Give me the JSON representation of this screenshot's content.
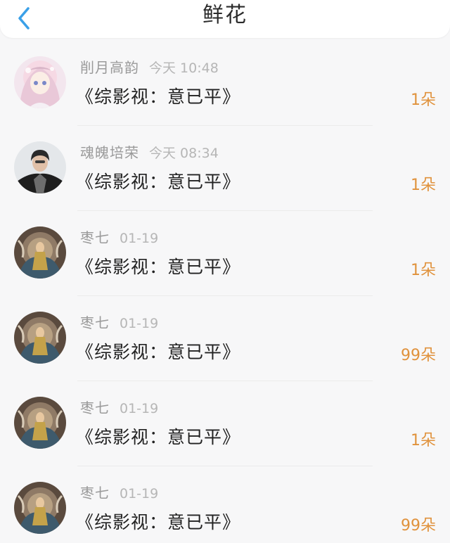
{
  "header": {
    "title": "鲜花",
    "back_icon": "chevron-left-icon",
    "accent_color": "#3aa0e8"
  },
  "records": [
    {
      "name": "削月高韵",
      "time": "今天 10:48",
      "book": "《综影视：意已平》",
      "count": "1朵",
      "avatar": "anime-girl"
    },
    {
      "name": "魂魄培荣",
      "time": "今天 08:34",
      "book": "《综影视：意已平》",
      "count": "1朵",
      "avatar": "person-photo"
    },
    {
      "name": "枣七",
      "time": "01-19",
      "book": "《综影视：意已平》",
      "count": "1朵",
      "avatar": "fantasy-art"
    },
    {
      "name": "枣七",
      "time": "01-19",
      "book": "《综影视：意已平》",
      "count": "99朵",
      "avatar": "fantasy-art"
    },
    {
      "name": "枣七",
      "time": "01-19",
      "book": "《综影视：意已平》",
      "count": "1朵",
      "avatar": "fantasy-art"
    },
    {
      "name": "枣七",
      "time": "01-19",
      "book": "《综影视：意已平》",
      "count": "99朵",
      "avatar": "fantasy-art"
    }
  ],
  "colors": {
    "count": "#e0923c",
    "name": "#9a9a9a",
    "time": "#b6b6b6"
  }
}
